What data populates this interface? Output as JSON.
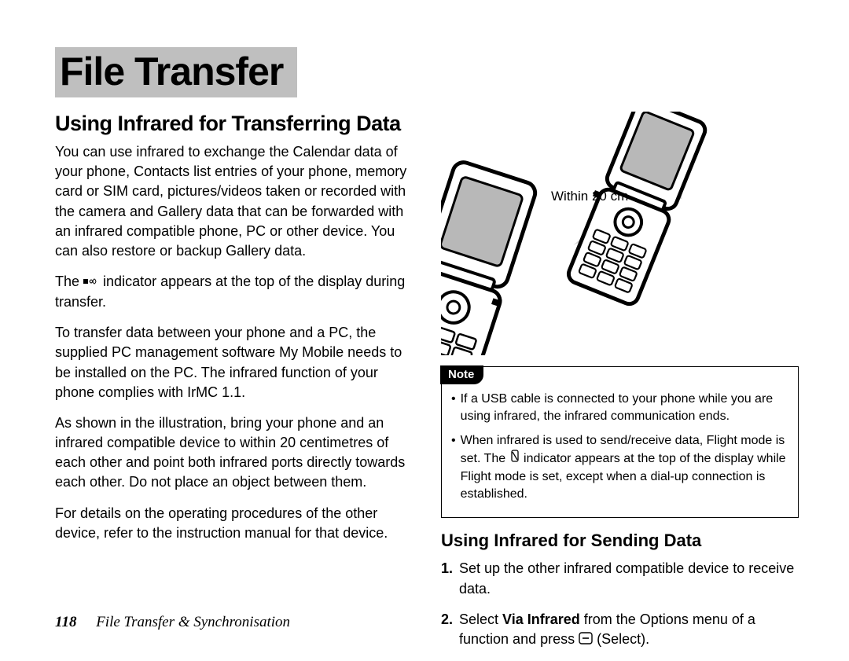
{
  "title": "File Transfer",
  "section1_heading": "Using Infrared for Transferring Data",
  "p1": "You can use infrared to exchange the Calendar data of your phone, Contacts list entries of your phone, memory card or SIM card, pictures/videos taken or recorded with the camera and Gallery data that can be forwarded with an infrared compatible phone, PC or other device. You can also restore or backup Gallery data.",
  "p2_pre": "The ",
  "p2_post": " indicator appears at the top of the display during transfer.",
  "p3": "To transfer data between your phone and a PC, the supplied PC management software My Mobile needs to be installed on the PC. The infrared function of your phone complies with IrMC 1.1.",
  "p4": "As shown in the illustration, bring your phone and an infrared compatible device to within 20 centimetres of each other and point both infrared ports directly towards each other. Do not place an object between them.",
  "p5": "For details on the operating procedures of the other device, refer to the instruction manual for that device.",
  "illustration_label": "Within 20 cm",
  "note_label": "Note",
  "note_items": {
    "n1": "If a USB cable is connected to your phone while you are using infrared, the infrared communication ends.",
    "n2a": "When infrared is used to send/receive data, Flight mode is set. The ",
    "n2b": " indicator appears at the top of the display while Flight mode is set, except when a dial-up connection is established."
  },
  "section2_heading": "Using Infrared for Sending Data",
  "steps": {
    "s1_num": "1.",
    "s1": "Set up the other infrared compatible device to receive data.",
    "s2_num": "2.",
    "s2_a": "Select ",
    "s2_b_bold": "Via Infrared",
    "s2_c": " from the Options menu of a function and press ",
    "s2_d": " (Select)."
  },
  "footer": {
    "page": "118",
    "section": "File Transfer & Synchronisation"
  }
}
